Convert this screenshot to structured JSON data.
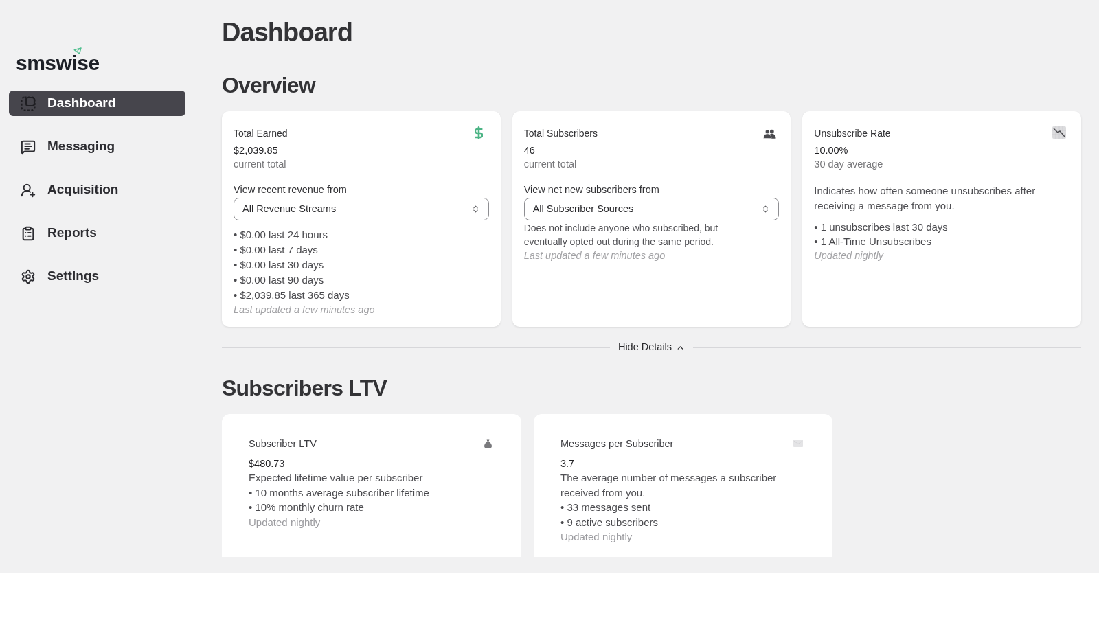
{
  "sidebar": {
    "logo": "smswise",
    "items": [
      {
        "label": "Dashboard",
        "selected": true
      },
      {
        "label": "Messaging",
        "selected": false
      },
      {
        "label": "Acquisition",
        "selected": false
      },
      {
        "label": "Reports",
        "selected": false
      },
      {
        "label": "Settings",
        "selected": false
      }
    ]
  },
  "page_title": "Dashboard",
  "overview": {
    "title": "Overview",
    "cards": [
      {
        "title": "Total Earned",
        "value": "$2,039.85",
        "caption": "current total",
        "filter": {
          "label": "View recent revenue from",
          "value": "All Revenue Streams"
        },
        "bullets": [
          "• $0.00 last 24 hours",
          "• $0.00 last 7 days",
          "• $0.00 last 30 days",
          "• $0.00 last 90 days",
          "• $2,039.85 last 365 days"
        ],
        "footnote": "Last updated a few minutes ago"
      },
      {
        "title": "Total Subscribers",
        "value": "46",
        "caption": "current total",
        "filter": {
          "label": "View net new subscribers from",
          "value": "All Subscriber Sources"
        },
        "description": "Does not include anyone who subscribed, but eventually opted out during the same period.",
        "footnote": "Last updated a few minutes ago"
      },
      {
        "title": "Unsubscribe Rate",
        "value": "10.00%",
        "caption": "30 day average",
        "description": "Indicates how often someone unsubscribes after receiving a message from you.",
        "bullets": [
          "• 1 unsubscribes last 30 days",
          "• 1 All-Time Unsubscribes"
        ],
        "footnote": "Updated nightly"
      }
    ]
  },
  "details_toggle": {
    "label": "Hide Details",
    "expanded": true
  },
  "subscribers_ltv": {
    "title": "Subscribers LTV",
    "cards": [
      {
        "title": "Subscriber LTV",
        "value": "$480.73",
        "description": "Expected lifetime value per subscriber",
        "bullets": [
          "• 10 months average subscriber lifetime",
          "• 10% monthly churn rate"
        ],
        "footnote": "Updated nightly"
      },
      {
        "title": "Messages per Subscriber",
        "value": "3.7",
        "description": "The average number of messages a subscriber received from you.",
        "bullets": [
          "• 33 messages sent",
          "• 9 active subscribers"
        ],
        "footnote": "Updated nightly"
      }
    ]
  }
}
